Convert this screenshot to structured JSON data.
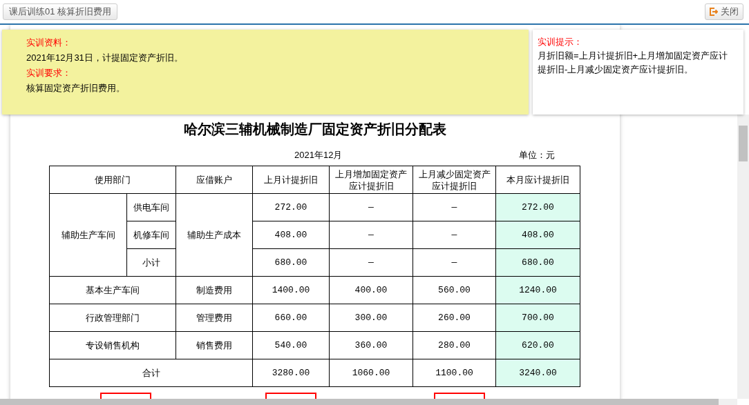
{
  "toolbar": {
    "title_button": "课后训练01 核算折旧费用",
    "close_button": "关闭"
  },
  "material": {
    "material_label": "实训资料：",
    "material_text": "2021年12月31日，计提固定资产折旧。",
    "requirement_label": "实训要求：",
    "requirement_text": "核算固定资产折旧费用。"
  },
  "hint": {
    "label": "实训提示：",
    "text": "月折旧额=上月计提折旧+上月增加固定资产应计提折旧-上月减少固定资产应计提折旧。"
  },
  "report": {
    "title": "哈尔滨三辅机械制造厂固定资产折旧分配表",
    "period": "2021年12月",
    "unit": "单位：元",
    "columns": [
      {
        "label": "使用部门",
        "highlighted": false
      },
      {
        "label": "应借账户",
        "highlighted": false
      },
      {
        "label": "上月计提折旧",
        "highlighted": false
      },
      {
        "label": "上月增加固定资产应计提折旧",
        "highlighted": false
      },
      {
        "label": "上月减少固定资产应计提折旧",
        "highlighted": false
      },
      {
        "label": "本月应计提折旧",
        "highlighted": true
      }
    ],
    "rows": [
      {
        "kind": "group",
        "department": "辅助生产车间",
        "account": "辅助生产成本",
        "children": [
          {
            "name": "供电车间",
            "values": [
              "272.00",
              "—",
              "—",
              "272.00"
            ]
          },
          {
            "name": "机修车间",
            "values": [
              "408.00",
              "—",
              "—",
              "408.00"
            ]
          },
          {
            "name": "小计",
            "values": [
              "680.00",
              "—",
              "—",
              "680.00"
            ]
          }
        ]
      },
      {
        "kind": "simple",
        "department": "基本生产车间",
        "account": "制造费用",
        "values": [
          "1400.00",
          "400.00",
          "560.00",
          "1240.00"
        ]
      },
      {
        "kind": "simple",
        "department": "行政管理部门",
        "account": "管理费用",
        "values": [
          "660.00",
          "300.00",
          "260.00",
          "700.00"
        ]
      },
      {
        "kind": "simple",
        "department": "专设销售机构",
        "account": "销售费用",
        "values": [
          "540.00",
          "360.00",
          "280.00",
          "620.00"
        ]
      },
      {
        "kind": "total",
        "label": "合计",
        "values": [
          "3280.00",
          "1060.00",
          "1100.00",
          "3240.00"
        ]
      }
    ]
  }
}
